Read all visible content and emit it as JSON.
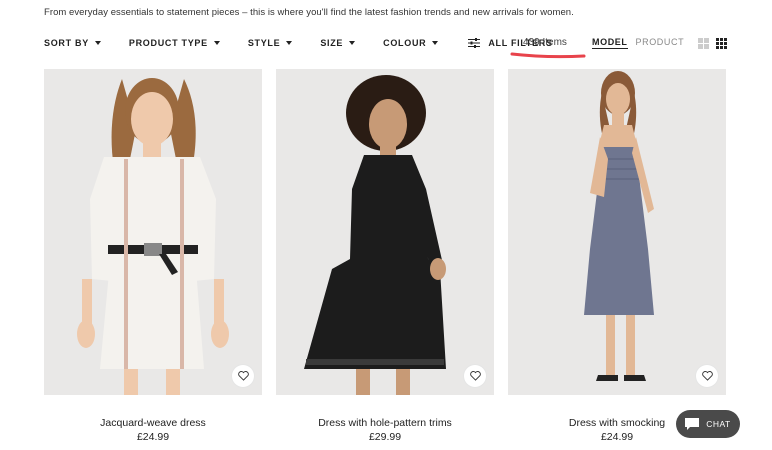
{
  "intro_text": "From everyday essentials to statement pieces – this is where you'll find the latest fashion trends and new arrivals for women.",
  "filters": [
    "SORT BY",
    "PRODUCT TYPE",
    "STYLE",
    "SIZE",
    "COLOUR"
  ],
  "all_filters_label": "ALL FILTERS",
  "item_count": "439 Items",
  "view_toggle": {
    "model": "MODEL",
    "product": "PRODUCT",
    "selected": "MODEL"
  },
  "grid_options": {
    "selected": "3-column"
  },
  "products": [
    {
      "name": "Jacquard-weave dress",
      "price": "£24.99",
      "dress_color": "#f4f2ee",
      "hair_color": "#9b6a3f"
    },
    {
      "name": "Dress with hole-pattern trims",
      "price": "£29.99",
      "dress_color": "#1c1c1c",
      "hair_color": "#2a1c14"
    },
    {
      "name": "Dress with smocking",
      "price": "£24.99",
      "dress_color": "#6f7690",
      "hair_color": "#8a5a38"
    }
  ],
  "chat_label": "CHAT",
  "colors": {
    "underline_annotation": "#e8434b",
    "chat_bg": "#4a4a4a"
  }
}
